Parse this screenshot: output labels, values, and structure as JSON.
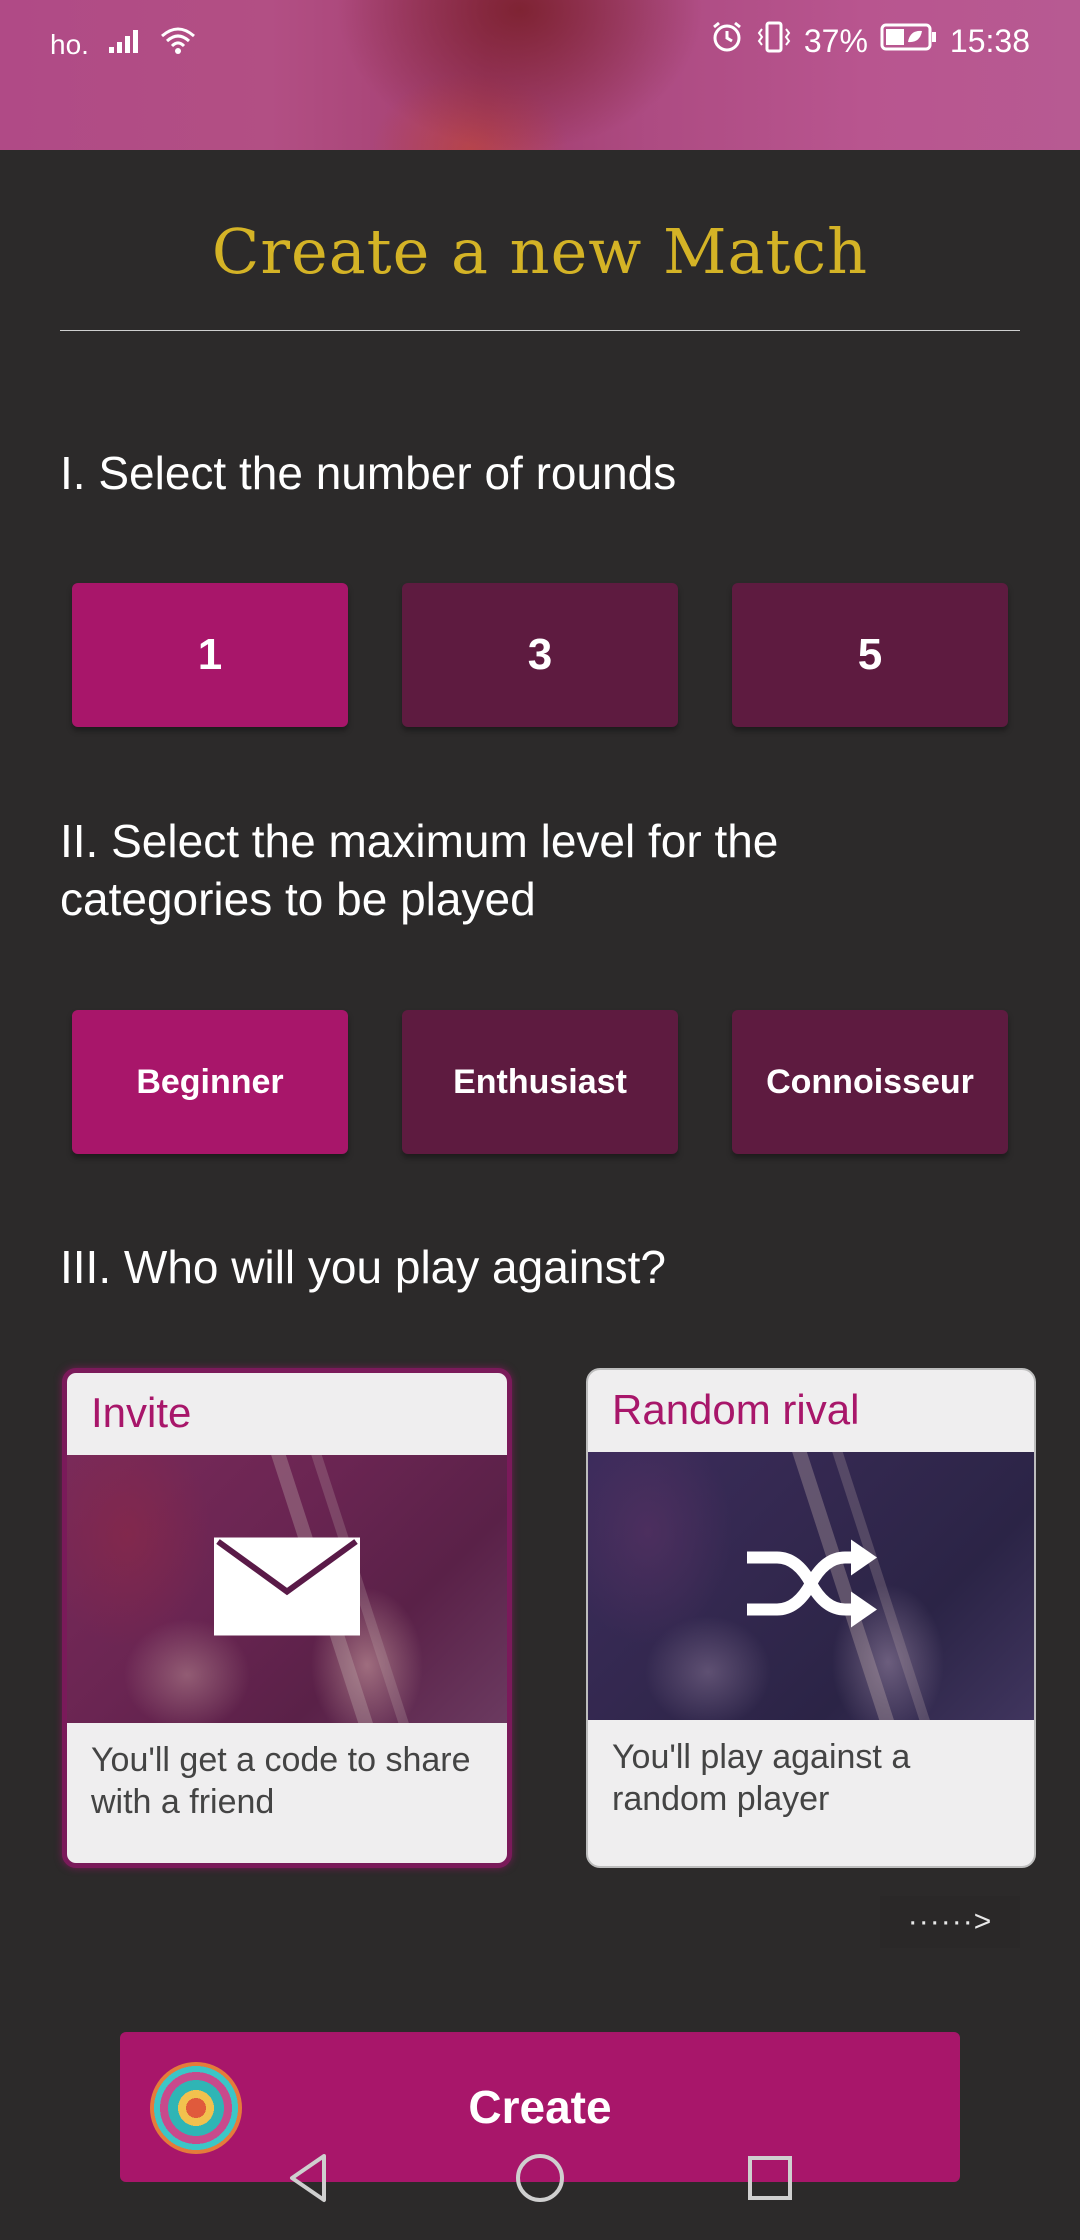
{
  "status_bar": {
    "carrier": "ho.",
    "battery_percent": "37%",
    "time": "15:38",
    "icons": [
      "signal-icon",
      "wifi-icon",
      "alarm-icon",
      "vibrate-icon",
      "battery-icon"
    ]
  },
  "title": "Create a new Match",
  "rounds": {
    "heading": "I. Select the number of rounds",
    "options": [
      "1",
      "3",
      "5"
    ],
    "selected": "1"
  },
  "levels": {
    "heading": "II. Select the maximum level for the categories to be played",
    "options": [
      "Beginner",
      "Enthusiast",
      "Connoisseur"
    ],
    "selected": "Beginner"
  },
  "opponent": {
    "heading": "III. Who will you play against?",
    "cards": [
      {
        "title": "Invite",
        "description": "You'll get a code to share with a friend",
        "icon": "envelope-icon",
        "selected": true
      },
      {
        "title": "Random rival",
        "description": "You'll play against a random player",
        "icon": "shuffle-icon",
        "selected": false
      }
    ],
    "scroll_hint": "······>"
  },
  "create_button": {
    "label": "Create",
    "icon": "mandala-logo-icon"
  },
  "colors": {
    "background": "#2c2a2a",
    "accent": "#a8166a",
    "unselected": "#5e1b40",
    "title": "#d4b326"
  },
  "navigation": {
    "buttons": [
      "back-icon",
      "home-icon",
      "recents-icon"
    ]
  }
}
